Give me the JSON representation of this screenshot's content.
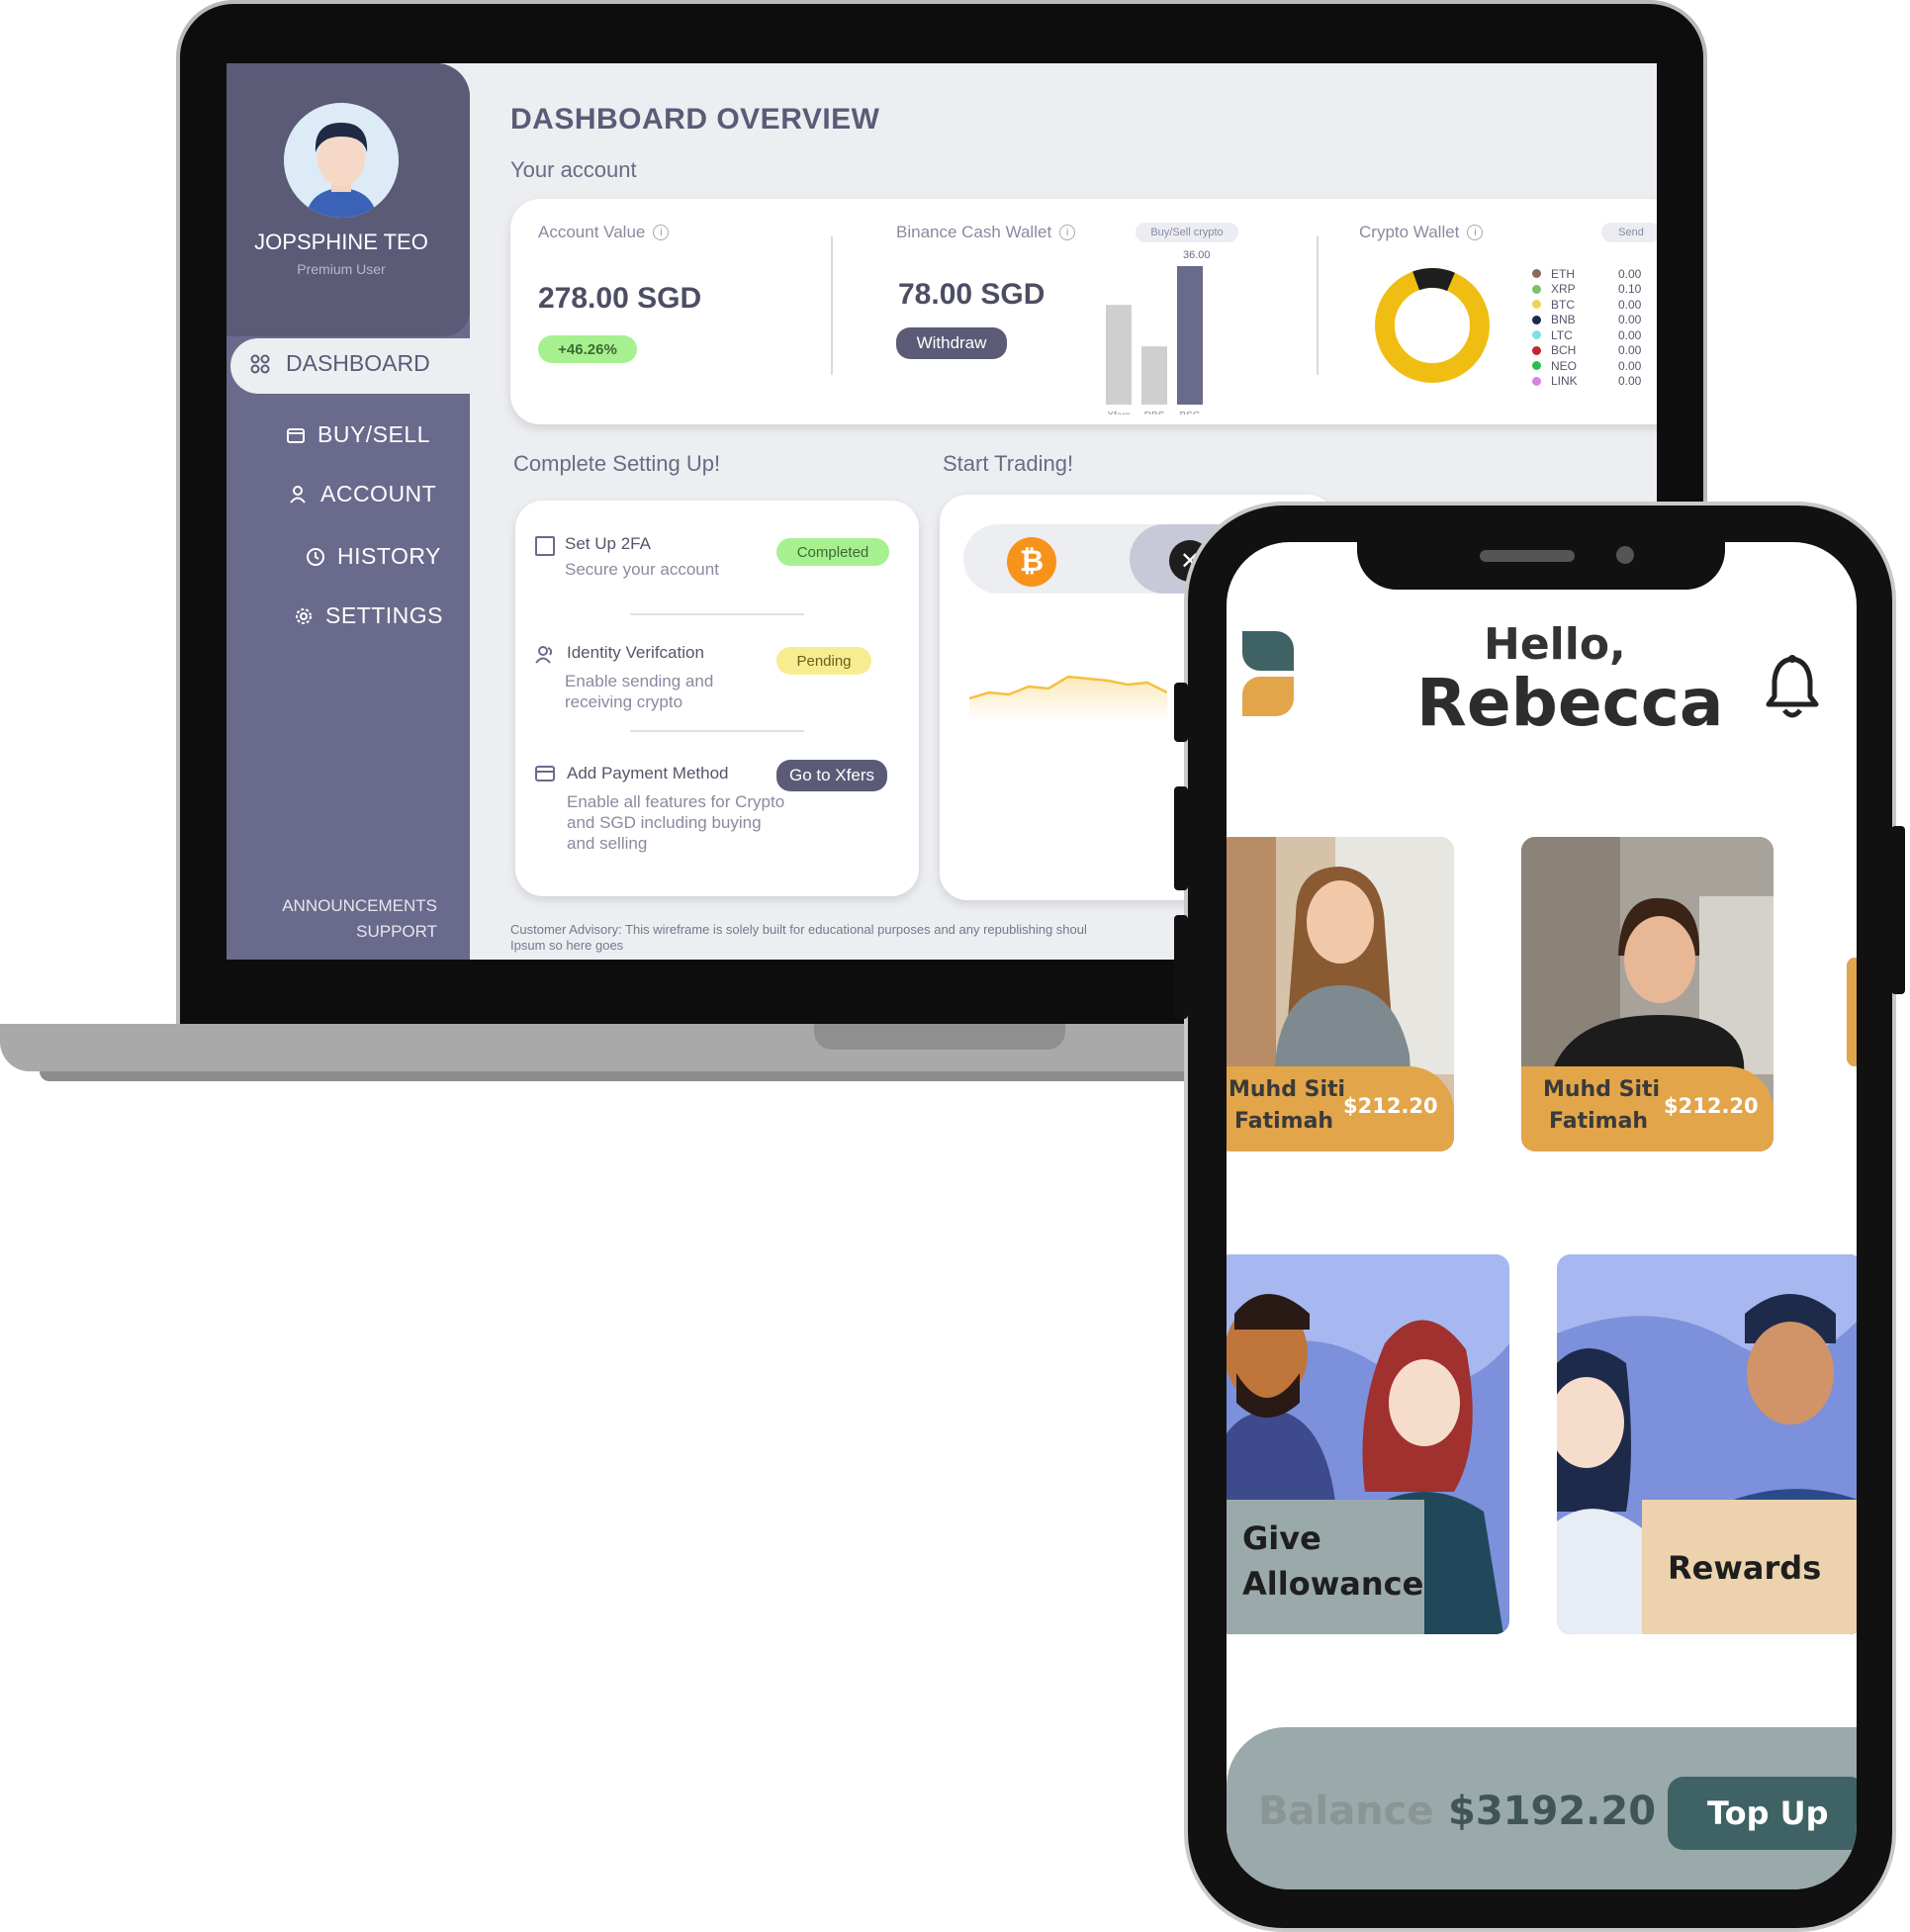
{
  "desktop": {
    "profile": {
      "name": "JOPSPHINE TEO",
      "role": "Premium User"
    },
    "nav": [
      {
        "label": "DASHBOARD",
        "icon": "grid-icon",
        "active": true
      },
      {
        "label": "BUY/SELL",
        "icon": "wallet-icon"
      },
      {
        "label": "ACCOUNT",
        "icon": "user-icon"
      },
      {
        "label": "HISTORY",
        "icon": "clock-icon"
      },
      {
        "label": "SETTINGS",
        "icon": "gear-icon"
      }
    ],
    "footer_links": {
      "announcements": "ANNOUNCEMENTS",
      "support": "SUPPORT"
    },
    "page_title": "DASHBOARD OVERVIEW",
    "section_account": "Your account",
    "account_value": {
      "label": "Account Value",
      "value": "278.00 SGD",
      "change": "+46.26%"
    },
    "cash_wallet": {
      "label": "Binance Cash Wallet",
      "badge": "Buy/Sell crypto",
      "value": "78.00 SGD",
      "withdraw": "Withdraw",
      "top_value": "36.00",
      "bars": [
        {
          "label": "Xfers",
          "value": 0.72,
          "color": "#cfcfcf"
        },
        {
          "label": "DBS",
          "value": 0.42,
          "color": "#cfcfcf"
        },
        {
          "label": "BSG",
          "value": 1.0,
          "color": "#6a6a8c"
        }
      ]
    },
    "crypto_wallet": {
      "label": "Crypto Wallet",
      "badge": "Send",
      "legend": [
        {
          "name": "ETH",
          "value": "0.00",
          "color": "#8b6a5a"
        },
        {
          "name": "XRP",
          "value": "0.10",
          "color": "#7fbf6a"
        },
        {
          "name": "BTC",
          "value": "0.00",
          "color": "#f0d35a"
        },
        {
          "name": "BNB",
          "value": "0.00",
          "color": "#1c2b4a"
        },
        {
          "name": "LTC",
          "value": "0.00",
          "color": "#7ee0e8"
        },
        {
          "name": "BCH",
          "value": "0.00",
          "color": "#c0282c"
        },
        {
          "name": "NEO",
          "value": "0.00",
          "color": "#2cc04a"
        },
        {
          "name": "LINK",
          "value": "0.00",
          "color": "#d784e0"
        }
      ],
      "donut": {
        "main_color": "#f0be12",
        "minor_color": "#1e1e1e",
        "minor_fraction": 0.12
      }
    },
    "setup": {
      "title": "Complete Setting Up!",
      "items": [
        {
          "title": "Set Up 2FA",
          "desc": "Secure your account",
          "status": "Completed",
          "icon": "checkbox-icon"
        },
        {
          "title": "Identity Verifcation",
          "desc": "Enable sending and receiving crypto",
          "status": "Pending",
          "icon": "people-icon"
        },
        {
          "title": "Add Payment Method",
          "desc": "Enable all features for Crypto and SGD including buying and selling",
          "status": "Go to Xfers",
          "icon": "card-icon"
        }
      ]
    },
    "trading": {
      "title": "Start Trading!"
    },
    "advisory": "Customer Advisory: This wireframe is solely built for educational purposes and any republishing shoul",
    "advisory_line2": "Ipsum so here goes"
  },
  "mobile": {
    "greeting": "Hello,",
    "name": "Rebecca",
    "kids": [
      {
        "name_line1": "Muhd Siti",
        "name_line2": "Fatimah",
        "amount": "$212.20"
      },
      {
        "name_line1": "Muhd Siti",
        "name_line2": "Fatimah",
        "amount": "$212.20"
      }
    ],
    "actions": [
      {
        "label_line1": "Give",
        "label_line2": "Allowance"
      },
      {
        "label_line1": "Rewards",
        "label_line2": ""
      }
    ],
    "balance_label": "Balance",
    "balance_value": "$3192.20",
    "top_up": "Top Up",
    "colors": {
      "accent": "#e2a54a",
      "teal": "#3f6265",
      "grey_panel": "#9aa9aa",
      "beige": "#ecd3ad"
    }
  }
}
